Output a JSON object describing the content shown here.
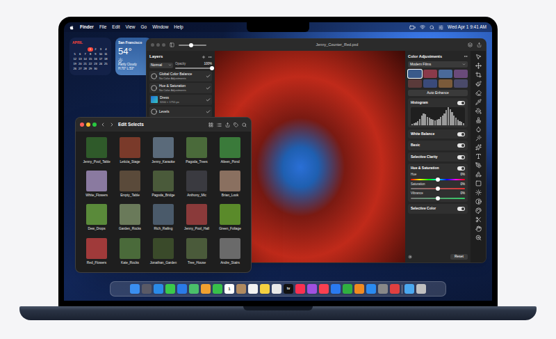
{
  "menu_bar": {
    "items": [
      {
        "label": "Finder",
        "kind": "app"
      },
      {
        "label": "File",
        "kind": "menu"
      },
      {
        "label": "Edit",
        "kind": "menu"
      },
      {
        "label": "View",
        "kind": "menu"
      },
      {
        "label": "Go",
        "kind": "menu"
      },
      {
        "label": "Window",
        "kind": "menu"
      },
      {
        "label": "Help",
        "kind": "menu"
      }
    ],
    "clock": "Wed Apr 1 9:41 AM"
  },
  "calendar_widget": {
    "month": "APRIL",
    "today": "1",
    "weeks": [
      [
        "",
        "",
        "",
        "1",
        "2",
        "3",
        "4"
      ],
      [
        "5",
        "6",
        "7",
        "8",
        "9",
        "10",
        "11"
      ],
      [
        "12",
        "13",
        "14",
        "15",
        "16",
        "17",
        "18"
      ],
      [
        "19",
        "20",
        "21",
        "22",
        "23",
        "24",
        "25"
      ],
      [
        "26",
        "27",
        "28",
        "29",
        "30",
        "",
        ""
      ]
    ]
  },
  "weather_widget": {
    "city": "San Francisco",
    "temperature": "54°",
    "condition": "Partly Cloudy",
    "range": "H:70° L:53°"
  },
  "app_window": {
    "title": "Jenny_Counter_Red.pxd",
    "zoom": {
      "level": 0.45
    },
    "layers_panel": {
      "title": "Layers",
      "blend_mode": "Normal",
      "opacity_label": "Opacity",
      "opacity": "100%",
      "opacity_level": 1,
      "layers": [
        {
          "name": "Global Color Balance",
          "detail": "No Color Adjustments",
          "kind": "adjustment",
          "checked": true
        },
        {
          "name": "Hue & Saturation",
          "detail": "No Color Adjustments",
          "kind": "adjustment",
          "checked": true
        },
        {
          "name": "Dress",
          "detail": "3200 × 1755 px",
          "kind": "image",
          "checked": true
        },
        {
          "name": "Levels",
          "detail": "",
          "kind": "adjustment",
          "checked": true
        }
      ]
    },
    "color_adjustments": {
      "title": "Color Adjustments",
      "preset_group": "Modern Films",
      "presets": [
        {
          "color": "#3a5a8a",
          "selected": true
        },
        {
          "color": "#8a3a4a",
          "selected": false
        },
        {
          "color": "#4a6a9a",
          "selected": false
        },
        {
          "color": "#6a4a7a",
          "selected": false
        },
        {
          "color": "#5a3a3a",
          "selected": false
        },
        {
          "color": "#3a4a7a",
          "selected": false
        },
        {
          "color": "#7a5a3a",
          "selected": false
        },
        {
          "color": "#4a4a6a",
          "selected": false
        }
      ],
      "auto_button": "Auto Enhance",
      "sections": [
        {
          "kind": "histogram",
          "label": "Histogram",
          "on": true,
          "values": [
            2,
            3,
            5,
            8,
            12,
            18,
            22,
            20,
            16,
            14,
            12,
            10,
            9,
            10,
            12,
            15,
            18,
            22,
            28,
            34,
            30,
            24,
            18,
            14,
            10,
            8,
            6,
            4
          ]
        },
        {
          "kind": "toggle",
          "label": "White Balance",
          "on": true
        },
        {
          "kind": "toggle",
          "label": "Basic",
          "on": true
        },
        {
          "kind": "toggle",
          "label": "Selective Clarity",
          "on": true
        },
        {
          "kind": "sliders",
          "label": "Hue & Saturation",
          "on": true,
          "sliders": [
            {
              "label": "Hue",
              "reading": "0%",
              "level": 0.5,
              "kind": "hue"
            },
            {
              "label": "Saturation",
              "reading": "0%",
              "level": 0.5,
              "kind": "saturation"
            },
            {
              "label": "Vibrance",
              "reading": "0%",
              "level": 0.5,
              "kind": "vibrance"
            }
          ]
        },
        {
          "kind": "toggle",
          "label": "Selective Color",
          "on": true
        }
      ],
      "reset_button": "Reset"
    }
  },
  "finder_window": {
    "title": "Edit Selects",
    "files": [
      {
        "name": "Jenny_Pool_Table",
        "color": "#2f5a2a"
      },
      {
        "name": "Leticia_Stage",
        "color": "#7a3a2a"
      },
      {
        "name": "Jenny_Karaoke",
        "color": "#5a6a7a"
      },
      {
        "name": "Pagoda_Trees",
        "color": "#4a6a3a"
      },
      {
        "name": "Aileen_Pond",
        "color": "#3a7a3a"
      },
      {
        "name": "White_Flowers",
        "color": "#8a7aa0"
      },
      {
        "name": "Empty_Table",
        "color": "#5a4a3a"
      },
      {
        "name": "Pagoda_Bridge",
        "color": "#4a5a3a"
      },
      {
        "name": "Anthony_Mic",
        "color": "#3a3a40"
      },
      {
        "name": "Brian_Look",
        "color": "#8a7060"
      },
      {
        "name": "Dew_Drops",
        "color": "#5a8a3a"
      },
      {
        "name": "Garden_Rocks",
        "color": "#6a7a5a"
      },
      {
        "name": "Rich_Railing",
        "color": "#4a5a6a"
      },
      {
        "name": "Jenny_Pool_Hall",
        "color": "#8a3a3a"
      },
      {
        "name": "Green_Foliage",
        "color": "#5a8a2a"
      },
      {
        "name": "Red_Flowers",
        "color": "#a03a3a"
      },
      {
        "name": "Kate_Rocks",
        "color": "#4a6a3a"
      },
      {
        "name": "Jonathan_Garden",
        "color": "#3a4a2a"
      },
      {
        "name": "Tree_House",
        "color": "#4a5a3a"
      },
      {
        "name": "Andre_Stairs",
        "color": "#6a6a6a"
      }
    ]
  },
  "dock": {
    "items": [
      {
        "kind": "app",
        "color": "#3a8ef0",
        "glyph": ""
      },
      {
        "kind": "app",
        "color": "#5a5a66",
        "glyph": ""
      },
      {
        "kind": "app",
        "color": "#2a8ae8",
        "glyph": ""
      },
      {
        "kind": "app",
        "color": "#3ac94a",
        "glyph": ""
      },
      {
        "kind": "app",
        "color": "#2a7ae8",
        "glyph": ""
      },
      {
        "kind": "app",
        "color": "#4ac06a",
        "glyph": ""
      },
      {
        "kind": "app",
        "color": "#f0a030",
        "glyph": ""
      },
      {
        "kind": "app",
        "color": "#38c04a",
        "glyph": ""
      },
      {
        "kind": "app",
        "color": "#ffffff",
        "glyph": "1"
      },
      {
        "kind": "app",
        "color": "#b08a60",
        "glyph": ""
      },
      {
        "kind": "app",
        "color": "#f2f2f2",
        "glyph": ""
      },
      {
        "kind": "app",
        "color": "#f5d040",
        "glyph": ""
      },
      {
        "kind": "app",
        "color": "#e8e8e8",
        "glyph": ""
      },
      {
        "kind": "app",
        "color": "#111111",
        "glyph": "tv"
      },
      {
        "kind": "app",
        "color": "#fa3050",
        "glyph": ""
      },
      {
        "kind": "app",
        "color": "#a050e0",
        "glyph": ""
      },
      {
        "kind": "app",
        "color": "#fa4050",
        "glyph": ""
      },
      {
        "kind": "app",
        "color": "#2a7af0",
        "glyph": ""
      },
      {
        "kind": "app",
        "color": "#30b040",
        "glyph": ""
      },
      {
        "kind": "app",
        "color": "#f08a20",
        "glyph": ""
      },
      {
        "kind": "app",
        "color": "#2a8af0",
        "glyph": ""
      },
      {
        "kind": "app",
        "color": "#888888",
        "glyph": ""
      },
      {
        "kind": "app",
        "color": "#e04040",
        "glyph": ""
      },
      {
        "kind": "separator",
        "color": "",
        "glyph": ""
      },
      {
        "kind": "app",
        "color": "#4aa8f0",
        "glyph": ""
      },
      {
        "kind": "app",
        "color": "#c0c0c0",
        "glyph": ""
      }
    ]
  }
}
